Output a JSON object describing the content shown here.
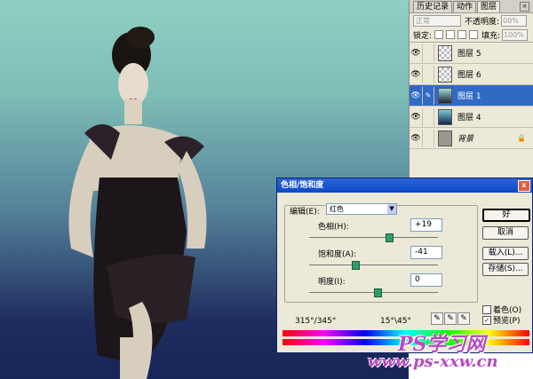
{
  "layers_panel": {
    "tabs": [
      "历史记录",
      "动作",
      "图层"
    ],
    "blend_mode": "正常",
    "opacity_label": "不透明度:",
    "opacity_value": "00%",
    "lock_label": "锁定:",
    "fill_label": "填充:",
    "fill_value": "100%",
    "layers": [
      {
        "name": "图层 5",
        "thumb": "checker"
      },
      {
        "name": "图层 6",
        "thumb": "checker"
      },
      {
        "name": "图层 1",
        "thumb": "photo"
      },
      {
        "name": "图层 4",
        "thumb": "gradient"
      },
      {
        "name": "背景",
        "thumb": "gray"
      }
    ]
  },
  "dialog": {
    "title": "色相/饱和度",
    "close": "x",
    "edit_label": "编辑(E):",
    "edit_value": "红色",
    "hue_label": "色相(H):",
    "hue_value": "+19",
    "saturation_label": "饱和度(A):",
    "saturation_value": "-41",
    "lightness_label": "明度(I):",
    "lightness_value": "0",
    "ok": "好",
    "cancel": "取消",
    "load": "载入(L)...",
    "save": "存储(S)...",
    "colorize": "着色(O)",
    "preview": "预览(P)",
    "range_left": "315°/345°",
    "range_right": "15°\\45°"
  },
  "watermark": {
    "line1": "PS学习网",
    "line2": "www.ps-xxw.cn"
  },
  "colors": {
    "selected_layer": "#316ac5",
    "title_bar": "#0b49c8",
    "watermark": "#b54cc1"
  }
}
